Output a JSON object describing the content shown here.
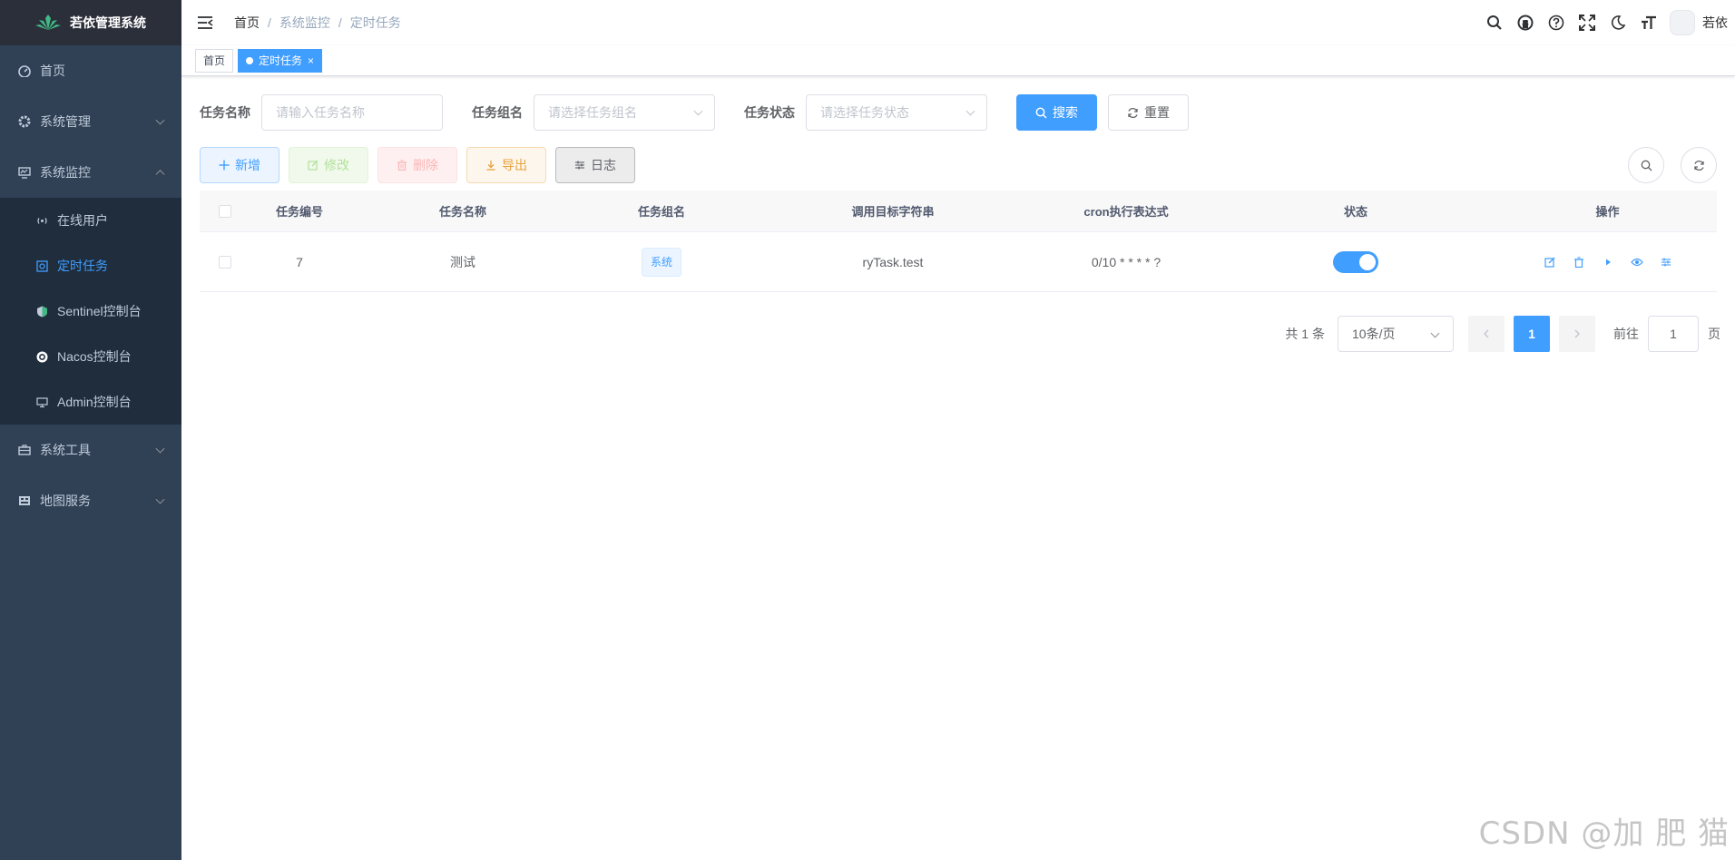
{
  "app": {
    "title": "若依管理系统"
  },
  "sidebar": {
    "items": [
      {
        "label": "首页",
        "icon": "dashboard-icon"
      },
      {
        "label": "系统管理",
        "icon": "gear-icon"
      },
      {
        "label": "系统监控",
        "icon": "monitor-icon"
      }
    ],
    "submenu": [
      {
        "label": "在线用户",
        "icon": "online-icon"
      },
      {
        "label": "定时任务",
        "icon": "job-icon",
        "active": true
      },
      {
        "label": "Sentinel控制台",
        "icon": "sentinel-icon"
      },
      {
        "label": "Nacos控制台",
        "icon": "nacos-icon"
      },
      {
        "label": "Admin控制台",
        "icon": "server-icon"
      }
    ],
    "items_after": [
      {
        "label": "系统工具",
        "icon": "toolbox-icon"
      },
      {
        "label": "地图服务",
        "icon": "map-icon"
      }
    ]
  },
  "navbar": {
    "breadcrumb": [
      "首页",
      "系统监控",
      "定时任务"
    ],
    "separator": "/",
    "username": "若依"
  },
  "tags": [
    {
      "label": "首页"
    },
    {
      "label": "定时任务",
      "active": true,
      "close": "×"
    }
  ],
  "search": {
    "job_name_label": "任务名称",
    "job_name_placeholder": "请输入任务名称",
    "job_group_label": "任务组名",
    "job_group_placeholder": "请选择任务组名",
    "job_status_label": "任务状态",
    "job_status_placeholder": "请选择任务状态",
    "search_button": "搜索",
    "reset_button": "重置"
  },
  "toolbar": {
    "add": "新增",
    "edit": "修改",
    "delete": "删除",
    "export": "导出",
    "log": "日志"
  },
  "table": {
    "headers": [
      "任务编号",
      "任务名称",
      "任务组名",
      "调用目标字符串",
      "cron执行表达式",
      "状态",
      "操作"
    ],
    "rows": [
      {
        "id": "7",
        "name": "测试",
        "group": "系统",
        "target": "ryTask.test",
        "cron": "0/10 * * * * ?",
        "status": true
      }
    ]
  },
  "pagination": {
    "total": "共 1 条",
    "page_size": "10条/页",
    "current": "1",
    "goto_label": "前往",
    "goto_value": "1",
    "page_suffix": "页"
  },
  "watermark": "CSDN @加 肥 猫",
  "colors": {
    "primary": "#409eff",
    "sidebar_bg": "#304156",
    "submenu_bg": "#1f2d3d"
  }
}
